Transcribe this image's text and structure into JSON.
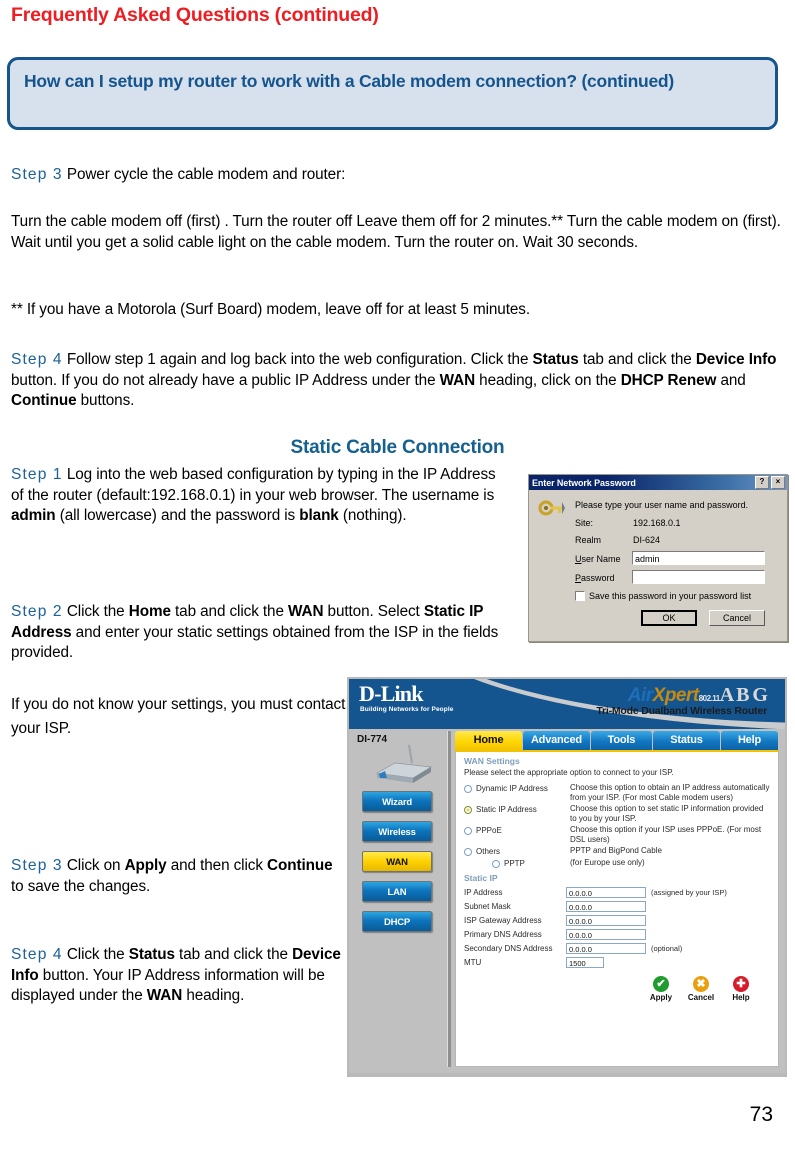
{
  "page": {
    "faq_title": "Frequently Asked Questions (continued)",
    "page_number": "73",
    "question": "How can I setup my router to work with a Cable modem connection? (continued)",
    "section_title": "Static Cable Connection",
    "colors": {
      "faq_red": "#ee1d22",
      "callout_border": "#15548d",
      "callout_fill": "#d6e1ed",
      "step_blue": "#1b6298",
      "section_blue": "#15608f"
    }
  },
  "body": {
    "step3_label": "Step 3",
    "step3_text": " Power cycle the cable modem and router:",
    "turn_text": "Turn the cable modem off (first) . Turn the router off Leave them off for 2 minutes.** Turn the cable modem on (first).  Wait until you get a solid cable light on the cable modem. Turn the router on. Wait 30 seconds.",
    "note_text": "** If you have a Motorola (Surf Board) modem, leave off for at least 5 minutes.",
    "step4_label": "Step 4",
    "step4_parts": {
      "t1": " Follow step 1 again and log back into the web configuration. Click the ",
      "b1": "Status",
      "t2": " tab and click the ",
      "b2": "Device Info",
      "t3": " button. If you do not already have a public IP Address under the ",
      "b3": "WAN",
      "t4": " heading, click on the ",
      "b4": "DHCP Renew",
      "t5": " and ",
      "b5": "Continue",
      "t6": " buttons."
    },
    "step1_label": "Step 1",
    "step1_parts": {
      "t1": " Log into the web based configuration by typing in the IP Address of the router (default:192.168.0.1) in your web browser. The username is ",
      "b1": "admin",
      "t2": " (all lowercase) and the password is ",
      "b2": "blank",
      "t3": " (nothing)."
    },
    "step2_label": "Step 2",
    "step2_parts": {
      "t1": " Click the ",
      "b1": "Home",
      "t2": " tab and click the ",
      "b2": "WAN",
      "t3": " button. Select ",
      "b3": "Static IP Address",
      "t4": " and enter your static settings obtained from the ISP in the fields provided."
    },
    "isp_text": "If you do not know your settings, you must contact your ISP.",
    "step3b_label": "Step 3",
    "step3b_parts": {
      "t1": " Click on ",
      "b1": "Apply",
      "t2": " and then click ",
      "b2": "Continue",
      "t3": " to save the changes."
    },
    "step4b_label": "Step 4",
    "step4b_parts": {
      "t1": " Click the ",
      "b1": "Status",
      "t2": " tab and click the ",
      "b2": "Device Info",
      "t3": " button. Your IP Address information will be displayed under the ",
      "b3": "WAN",
      "t4": " heading."
    }
  },
  "password_dialog": {
    "title": "Enter Network Password",
    "help_button": "?",
    "close_button": "×",
    "prompt": "Please type your user name and password.",
    "site_label": "Site:",
    "site_value": "192.168.0.1",
    "realm_label": "Realm",
    "realm_value": "DI-624",
    "username_label": "User Name",
    "username_value": "admin",
    "password_label": "Password",
    "password_value": "",
    "save_checkbox_label": "Save this password in your password list",
    "save_checked": false,
    "ok_label": "OK",
    "cancel_label": "Cancel"
  },
  "router_ui": {
    "brand": "D-Link",
    "brand_tagline": "Building Networks for People",
    "product_air": "Air",
    "product_xpert": "Xpert",
    "product_tm": "™",
    "product_std": "802.11",
    "product_abg": "A B G",
    "product_subtitle": "Tri-Mode Dualband Wireless Router",
    "model": "DI-774",
    "sidebar_buttons": [
      {
        "label": "Wizard",
        "active": false
      },
      {
        "label": "Wireless",
        "active": false
      },
      {
        "label": "WAN",
        "active": true
      },
      {
        "label": "LAN",
        "active": false
      },
      {
        "label": "DHCP",
        "active": false
      }
    ],
    "tabs": [
      {
        "label": "Home",
        "active": true,
        "width": 68
      },
      {
        "label": "Advanced",
        "active": false,
        "width": 68
      },
      {
        "label": "Tools",
        "active": false,
        "width": 62
      },
      {
        "label": "Status",
        "active": false,
        "width": 68
      },
      {
        "label": "Help",
        "active": false,
        "width": 58
      }
    ],
    "panel": {
      "title": "WAN Settings",
      "subtitle": "Please select the appropriate option to connect to your ISP.",
      "options": [
        {
          "label": "Dynamic IP Address",
          "selected": false,
          "desc": "Choose this option to obtain an IP address automatically from your ISP. (For most Cable modem users)",
          "indent": false
        },
        {
          "label": "Static IP Address",
          "selected": true,
          "desc": "Choose this option to set static IP information provided to you by your ISP.",
          "indent": false
        },
        {
          "label": "PPPoE",
          "selected": false,
          "desc": "Choose this option if your ISP uses PPPoE. (For most DSL users)",
          "indent": false
        },
        {
          "label": "Others",
          "selected": false,
          "desc": "PPTP and BigPond Cable",
          "indent": false
        },
        {
          "label": "PPTP",
          "selected": false,
          "desc": "(for Europe use only)",
          "indent": true
        }
      ],
      "static_heading": "Static IP",
      "fields": [
        {
          "label": "IP Address",
          "value": "0.0.0.0",
          "note": "(assigned by your ISP)",
          "short": false
        },
        {
          "label": "Subnet Mask",
          "value": "0.0.0.0",
          "note": "",
          "short": false
        },
        {
          "label": "ISP Gateway Address",
          "value": "0.0.0.0",
          "note": "",
          "short": false
        },
        {
          "label": "Primary DNS Address",
          "value": "0.0.0.0",
          "note": "",
          "short": false
        },
        {
          "label": "Secondary DNS Address",
          "value": "0.0.0.0",
          "note": "(optional)",
          "short": false
        },
        {
          "label": "MTU",
          "value": "1500",
          "note": "",
          "short": true
        }
      ],
      "actions": [
        {
          "label": "Apply",
          "glyph": "✔",
          "color": "#1f9c2f"
        },
        {
          "label": "Cancel",
          "glyph": "✖",
          "color": "#e8a010"
        },
        {
          "label": "Help",
          "glyph": "✚",
          "color": "#d81b28"
        }
      ]
    }
  }
}
